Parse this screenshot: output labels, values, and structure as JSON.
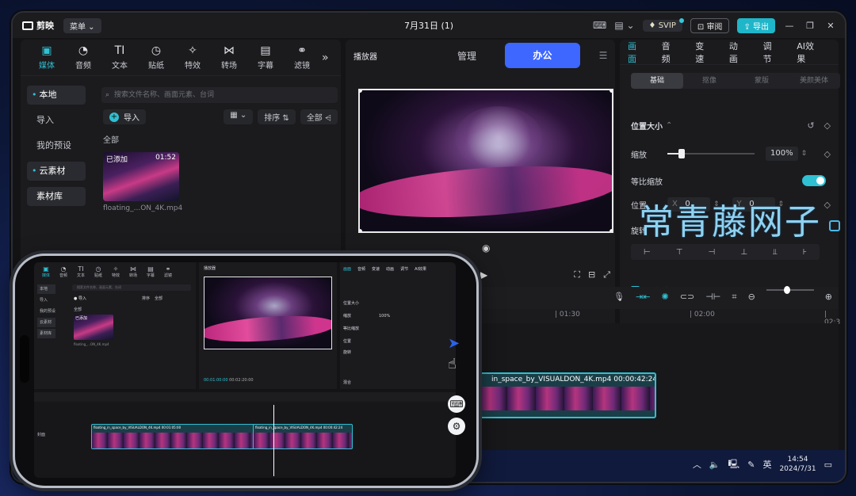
{
  "app": {
    "name": "剪映",
    "menu": "菜单",
    "title": "7月31日 (1)",
    "svip": "SVIP",
    "review": "审阅",
    "export": "导出"
  },
  "left": {
    "tools": [
      {
        "label": "媒体",
        "icon": "media-icon",
        "glyph": "▣"
      },
      {
        "label": "音频",
        "icon": "audio-icon",
        "glyph": "◔"
      },
      {
        "label": "文本",
        "icon": "text-icon",
        "glyph": "TI"
      },
      {
        "label": "贴纸",
        "icon": "sticker-icon",
        "glyph": "◷"
      },
      {
        "label": "特效",
        "icon": "effects-icon",
        "glyph": "✧"
      },
      {
        "label": "转场",
        "icon": "transition-icon",
        "glyph": "⋈"
      },
      {
        "label": "字幕",
        "icon": "caption-icon",
        "glyph": "▤"
      },
      {
        "label": "滤镜",
        "icon": "filter-icon",
        "glyph": "⚭"
      }
    ],
    "sidebar": [
      "本地",
      "导入",
      "我的预设",
      "云素材",
      "素材库"
    ],
    "search_placeholder": "搜索文件名称、画面元素、台词",
    "import_label": "导入",
    "sort_label": "排序",
    "all_filter": "全部",
    "section_all": "全部",
    "media": {
      "badge": "已添加",
      "duration": "01:52",
      "name": "floating_...ON_4K.mp4"
    }
  },
  "center": {
    "tabs": [
      "播放器",
      "管理",
      "办公"
    ],
    "active_tab": "办公"
  },
  "right": {
    "tabs": [
      "画面",
      "音频",
      "变速",
      "动画",
      "调节",
      "AI效果"
    ],
    "subtabs": [
      "基础",
      "抠像",
      "蒙版",
      "美颜美体"
    ],
    "position_size": "位置大小",
    "scale_label": "缩放",
    "scale_value": "100%",
    "scale_fraction": 0.16,
    "uniform_scale": "等比缩放",
    "position_label": "位置",
    "pos_x_label": "X",
    "pos_x": "0",
    "pos_y_label": "Y",
    "pos_y": "0",
    "rotate_label": "旋转",
    "blend_label": "混合"
  },
  "timeline": {
    "ticks": [
      "| 01:30",
      "| 02:00",
      "| 02:3"
    ],
    "clip_label": "in_space_by_VISUALDON_4K.mp4  00:00:42:24"
  },
  "phone": {
    "time": "00:01:00:00",
    "total": "00:02:20:00",
    "cover": "封面",
    "clip1": "floating_in_space_by_VISUALDON_4K.mp4  00:01:05:00",
    "clip2": "floating_in_space_by_VISUALDON_4K.mp4  00:00:42:24"
  },
  "taskbar": {
    "ime": "英",
    "time": "14:54",
    "date": "2024/7/31"
  },
  "watermark": "常青藤网子",
  "colors": {
    "accent": "#2fc0d2",
    "segment_active": "#3d67ff"
  }
}
